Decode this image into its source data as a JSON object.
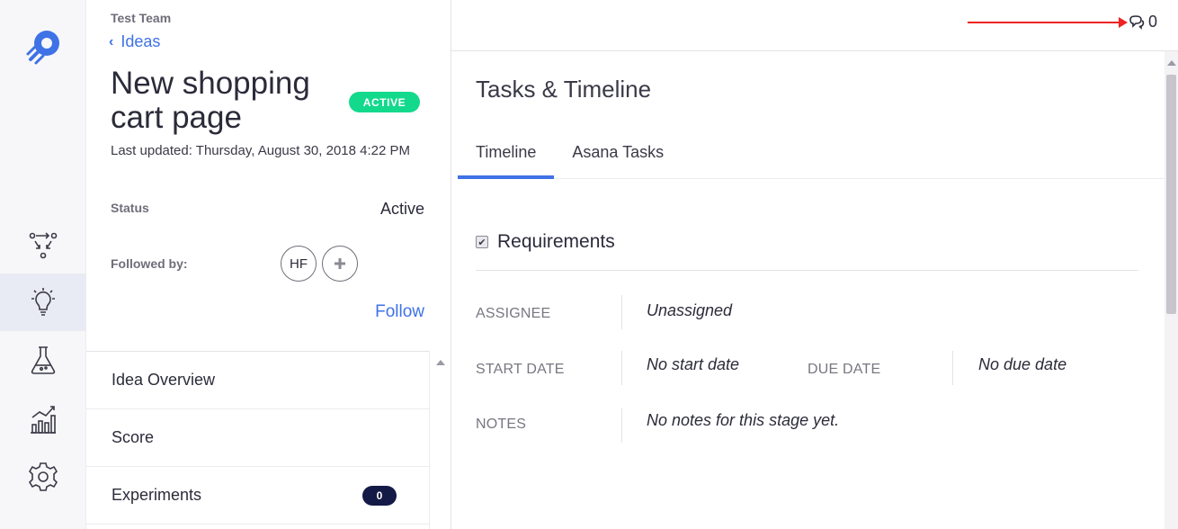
{
  "sidebar": {
    "icons": [
      "rocket-logo",
      "flow-icon",
      "lightbulb-icon",
      "flask-icon",
      "chart-icon",
      "gear-icon"
    ],
    "active": "lightbulb-icon"
  },
  "idea": {
    "team": "Test Team",
    "back_label": "Ideas",
    "title": "New shopping cart page",
    "badge": "ACTIVE",
    "last_updated": "Last updated: Thursday, August 30, 2018 4:22 PM",
    "status_label": "Status",
    "status_value": "Active",
    "followed_label": "Followed by:",
    "follower_initials": "HF",
    "follow_label": "Follow",
    "menu": [
      {
        "label": "Idea Overview"
      },
      {
        "label": "Score"
      },
      {
        "label": "Experiments",
        "count": "0"
      }
    ]
  },
  "topbar": {
    "comment_count": "0"
  },
  "main": {
    "section_title": "Tasks & Timeline",
    "tabs": [
      {
        "label": "Timeline",
        "active": true
      },
      {
        "label": "Asana Tasks",
        "active": false
      }
    ],
    "stage": {
      "name": "Requirements",
      "checked": true,
      "assignee_label": "ASSIGNEE",
      "assignee_value": "Unassigned",
      "start_label": "START DATE",
      "start_value": "No start date",
      "due_label": "DUE DATE",
      "due_value": "No due date",
      "notes_label": "NOTES",
      "notes_value": "No notes for this stage yet."
    }
  },
  "colors": {
    "accent": "#3f72e6",
    "badge": "#13d98c",
    "pill": "#141a46",
    "annotation_arrow": "#ee2222"
  }
}
